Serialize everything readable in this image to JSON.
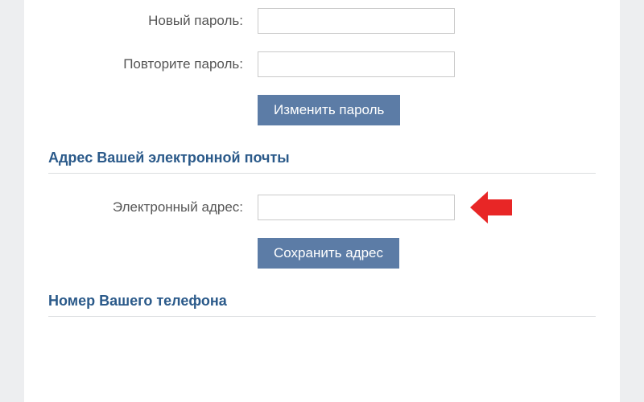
{
  "password": {
    "newLabel": "Новый пароль:",
    "repeatLabel": "Повторите пароль:",
    "buttonLabel": "Изменить пароль"
  },
  "email": {
    "sectionTitle": "Адрес Вашей электронной почты",
    "fieldLabel": "Электронный адрес:",
    "buttonLabel": "Сохранить адрес"
  },
  "phone": {
    "sectionTitle": "Номер Вашего телефона"
  }
}
